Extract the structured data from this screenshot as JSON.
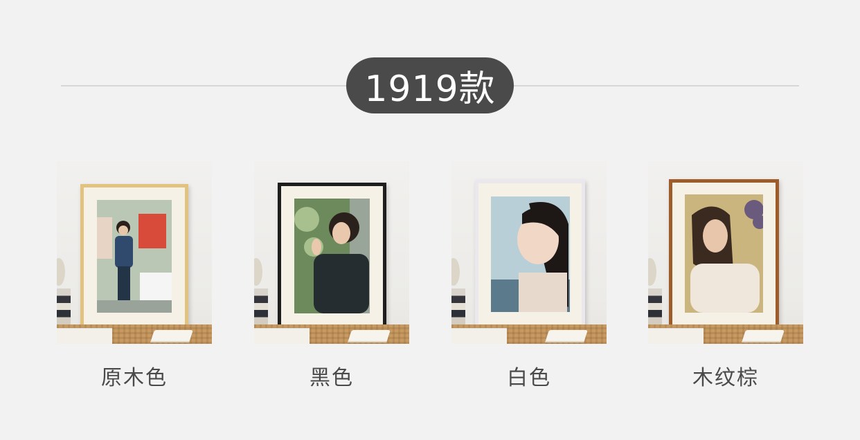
{
  "header": {
    "title": "1919款"
  },
  "options": [
    {
      "label": "原木色",
      "frame_color": "#e2c27f",
      "photo": {
        "bg": "#b9c7b4",
        "accent": "#d84a3a",
        "figure": "#2f4a6c",
        "skin": "#e6c7a9",
        "hair": "#2a1f1a"
      }
    },
    {
      "label": "黑色",
      "frame_color": "#1e1e1e",
      "photo": {
        "bg": "#6d8a5c",
        "accent": "#a8c08e",
        "figure": "#262d30",
        "skin": "#e9c8ad",
        "hair": "#2b211c"
      }
    },
    {
      "label": "白色",
      "frame_color": "#eae8ec",
      "photo": {
        "bg": "#b8cfd8",
        "accent": "#e7d9cc",
        "figure": "#5b7b8c",
        "skin": "#f1d7c6",
        "hair": "#1d1716"
      }
    },
    {
      "label": "木纹棕",
      "frame_color": "#9e5c2a",
      "photo": {
        "bg": "#c9b57d",
        "accent": "#6a5a7d",
        "figure": "#efe6dc",
        "skin": "#e7c6ab",
        "hair": "#3a2a20"
      }
    }
  ]
}
